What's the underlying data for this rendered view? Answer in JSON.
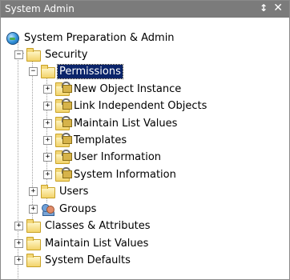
{
  "panel": {
    "title": "System Admin",
    "pin_glyph": "↕",
    "close_glyph": "✕"
  },
  "tree": {
    "root": "System Preparation & Admin",
    "security": "Security",
    "permissions": "Permissions",
    "new_object_instance": "New Object Instance",
    "link_independent_objects": "Link Independent Objects",
    "maintain_list_values_perm": "Maintain List Values",
    "templates": "Templates",
    "user_information": "User Information",
    "system_information": "System Information",
    "users": "Users",
    "groups": "Groups",
    "classes_attributes": "Classes & Attributes",
    "maintain_list_values": "Maintain List Values",
    "system_defaults": "System Defaults",
    "expand_plus": "+",
    "collapse_minus": "−"
  },
  "colors": {
    "titlebar": "#7b7b7b",
    "selection": "#0a246a"
  }
}
